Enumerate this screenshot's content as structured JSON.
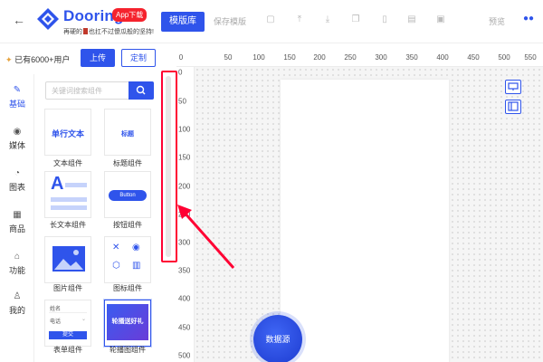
{
  "header": {
    "back_icon": "arrow-left-icon",
    "logo_text": "Dooring",
    "app_badge": "App下载",
    "slogan_before": "再硬的",
    "slogan_after": "也扛不过傻瓜般的坚持!",
    "template_lib": "模版库",
    "save_template": "保存模版",
    "preview": "预览",
    "tool_icons": [
      "save-icon",
      "upload-icon",
      "download-icon",
      "copy-icon",
      "mobile-icon",
      "delete-icon",
      "qrcode-icon"
    ],
    "accent_color": "#2f54eb"
  },
  "users": {
    "label": "已有6000+用户",
    "upload": "上传",
    "custom": "定制"
  },
  "search": {
    "placeholder": "关键词搜索组件"
  },
  "nav": {
    "items": [
      {
        "label": "基础",
        "icon": "pen-icon",
        "active": true
      },
      {
        "label": "媒体",
        "icon": "play-circle-icon",
        "active": false
      },
      {
        "label": "图表",
        "icon": "pie-chart-icon",
        "active": false
      },
      {
        "label": "商品",
        "icon": "shop-icon",
        "active": false
      },
      {
        "label": "功能",
        "icon": "puzzle-icon",
        "active": false
      },
      {
        "label": "我的",
        "icon": "user-icon",
        "active": false
      }
    ]
  },
  "components": {
    "text": {
      "preview": "单行文本",
      "caption": "文本组件"
    },
    "title": {
      "preview": "标题",
      "caption": "标题组件"
    },
    "longtext": {
      "preview": "A",
      "caption": "长文本组件"
    },
    "button": {
      "preview": "Button",
      "caption": "按钮组件"
    },
    "image": {
      "caption": "图片组件"
    },
    "icon": {
      "caption": "图标组件"
    },
    "form": {
      "name_label": "姓名",
      "phone_label": "电话",
      "submit": "提交",
      "caption": "表单组件"
    },
    "carousel": {
      "preview": "轮播送好礼",
      "caption": "轮播图组件"
    }
  },
  "ruler": {
    "x_ticks": [
      "0",
      "50",
      "100",
      "150",
      "200",
      "250",
      "300",
      "350",
      "400",
      "450",
      "500",
      "550"
    ],
    "y_ticks": [
      "0",
      "50",
      "100",
      "150",
      "200",
      "250",
      "300",
      "350",
      "400",
      "450",
      "500"
    ]
  },
  "datasource": "数据源"
}
